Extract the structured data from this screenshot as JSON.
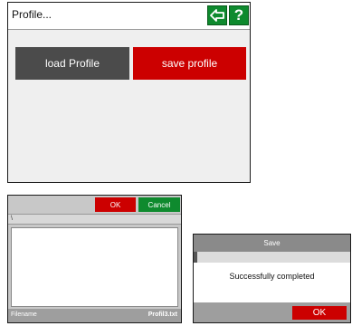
{
  "profile_window": {
    "title": "Profile...",
    "back_icon": "arrow-left-icon",
    "help_label": "?",
    "load_button": "load Profile",
    "save_button": "save profile"
  },
  "file_dialog": {
    "ok_label": "OK",
    "cancel_label": "Cancel",
    "path_text": "\\",
    "filename_label": "Filename",
    "filename_value": "Profil3.txt"
  },
  "save_dialog": {
    "title": "Save",
    "message": "Successfully completed",
    "ok_label": "OK"
  },
  "colors": {
    "accent_green": "#0e8a2e",
    "accent_red": "#cc0000",
    "button_dark": "#4b4b4b"
  }
}
